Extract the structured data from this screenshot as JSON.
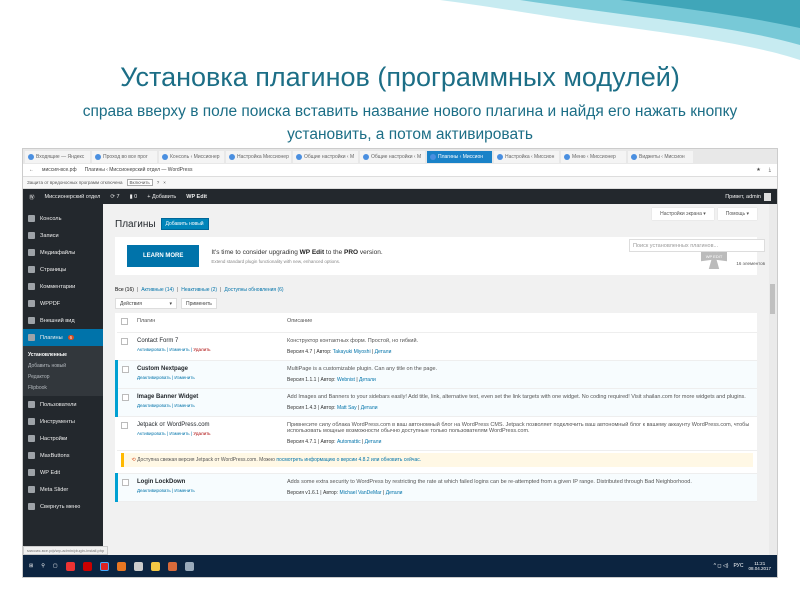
{
  "slide": {
    "title": "Установка плагинов (программных модулей)",
    "subtitle": "справа вверху в поле поиска вставить название нового плагина и найдя его нажать кнопку установить, а потом активировать"
  },
  "browser": {
    "tabs": [
      "Входящие — Яндекс",
      "Проход во все прог",
      "Консоль ‹ Миссионер",
      "Настройка Миссионер",
      "Общие настройки ‹ М",
      "Общие настройки ‹ М",
      "Плагины ‹ Миссион",
      "Настройка ‹ Миссион",
      "Меню ‹ Миссионер",
      "Виджеты ‹ Миссион"
    ],
    "active_tab": 6,
    "url": "миссия-все.рф",
    "page_title": "Плагины ‹ Миссионерский отдел — WordPress",
    "protection_text": "Защита от вредоносных программ отключена",
    "protection_button": "Включить",
    "protection_help": "?"
  },
  "adminbar": {
    "site": "Миссионерский отдел",
    "updates": "7",
    "comments": "0",
    "add": "Добавить",
    "wpedit": "WP Edit",
    "greeting": "Привет, admin"
  },
  "sidebar": {
    "items": [
      {
        "label": "Консоль"
      },
      {
        "label": "Записи"
      },
      {
        "label": "Медиафайлы"
      },
      {
        "label": "Страницы"
      },
      {
        "label": "Комментарии"
      },
      {
        "label": "WPPDF"
      },
      {
        "label": "Внешний вид"
      },
      {
        "label": "Плагины",
        "badge": "6"
      }
    ],
    "submenu": [
      "Установленные",
      "Добавить новый",
      "Редактор",
      "Flipbook"
    ],
    "items2": [
      {
        "label": "Пользователи"
      },
      {
        "label": "Инструменты"
      },
      {
        "label": "Настройки"
      },
      {
        "label": "MaxButtons"
      },
      {
        "label": "WP Edit"
      },
      {
        "label": "Meta Slider"
      },
      {
        "label": "Свернуть меню"
      }
    ]
  },
  "main": {
    "screen_options": "Настройки экрана ▾",
    "help": "Помощь ▾",
    "heading": "Плагины",
    "add_new": "Добавить новый",
    "notice": {
      "button": "LEARN MORE",
      "t_a": "It's time to consider upgrading ",
      "t_b": "WP Edit",
      "t_c": " to the ",
      "t_d": "PRO",
      "t_e": " version.",
      "sub": "Extend standard plugin functionality with new, enhanced options.",
      "logo": "WP EDIT",
      "close": "×"
    },
    "filters": {
      "all": "Все (16)",
      "active": "Активные (14)",
      "inactive": "Неактивные (2)",
      "updates": "Доступны обновления (6)"
    },
    "search_placeholder": "Поиск установленных плагинов...",
    "count": "16 элементов",
    "bulk": "Действия",
    "apply": "Применить",
    "col_plugin": "Плагин",
    "col_desc": "Описание",
    "plugins": [
      {
        "name": "Contact Form 7",
        "a1": "Активировать",
        "a2": "Изменить",
        "a3": "Удалить",
        "desc": "Конструктор контактных форм. Простой, но гибкий.",
        "version": "Версия 4.7 | Автор: ",
        "author": "Takayuki Miyoshi",
        "details": "Детали"
      },
      {
        "name": "Custom Nextpage",
        "a1": "Деактивировать",
        "a2": "Изменить",
        "desc": "MultiPage is a customizable plugin. Can any title on the page.",
        "version": "Версия 1.1.1 | Автор: ",
        "author": "Webnist",
        "details": "Детали"
      },
      {
        "name": "Image Banner Widget",
        "a1": "Деактивировать",
        "a2": "Изменить",
        "desc": "Add Images and Banners to your sidebars easily! Add title, link, alternative text, even set the link targets with one widget. No coding required! Visit shailan.com for more widgets and plugins.",
        "version": "Версия 1.4.3 | Автор: ",
        "author": "Matt Say",
        "details": "Детали"
      },
      {
        "name": "Jetpack от WordPress.com",
        "a1": "Активировать",
        "a2": "Изменить",
        "a3": "Удалить",
        "desc": "Привнесите силу облака WordPress.com в ваш автономный блог на WordPress CMS. Jetpack позволяет подключить ваш автономный блог к вашему аккаунту WordPress.com, чтобы использовать мощные возможности обычно доступные только пользователям WordPress.com.",
        "version": "Версия 4.7.1 | Автор: ",
        "author": "Automattic",
        "details": "Детали"
      },
      {
        "name": "Login LockDown",
        "a1": "Деактивировать",
        "a2": "Изменить",
        "desc": "Adds some extra security to WordPress by restricting the rate at which failed logins can be re-attempted from a given IP range. Distributed through Bad Neighborhood.",
        "version": "Версия v1.6.1 | Автор: ",
        "author": "Michael VanDeMar",
        "details": "Детали"
      }
    ],
    "update_notice": {
      "text": "Доступна свежая версия Jetpack от WordPress.com. Можно ",
      "link": "посмотреть информацию о версии 4.8.2 или обновить сейчас."
    }
  },
  "statusbar": "миссия-все.рф/wp-admin/plugin-install.php",
  "taskbar": {
    "lang": "РУС",
    "time": "11:21",
    "date": "08.04.2017"
  }
}
